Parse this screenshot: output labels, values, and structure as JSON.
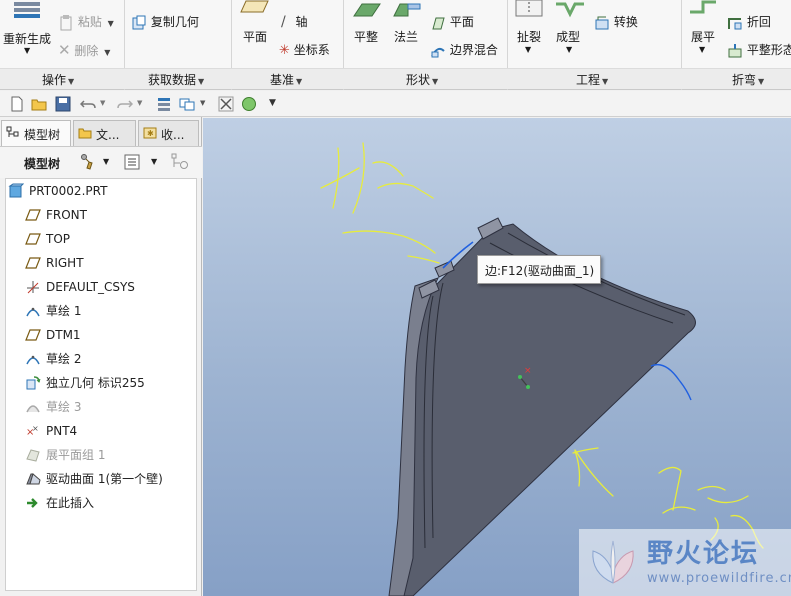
{
  "ribbon": {
    "regenerate_label": "重新生成",
    "paste_label": "粘贴",
    "delete_label": "删除",
    "copy_geometry_label": "复制几何",
    "plane_label": "平面",
    "axis_label": "轴",
    "csys_label": "坐标系",
    "flatten_label": "平整",
    "flange_label": "法兰",
    "surf_plane_label": "平面",
    "boundary_blend_label": "边界混合",
    "rip_label": "扯裂",
    "form_label": "成型",
    "convert_label": "转换",
    "unbend_label": "展平",
    "bend_back_label": "折回",
    "flat_pattern_label": "平整形态",
    "groups": {
      "operations": "操作",
      "get_data": "获取数据",
      "datum": "基准",
      "shapes": "形状",
      "engineering": "工程",
      "bends": "折弯"
    }
  },
  "left_panel": {
    "tabs": [
      "模型树",
      "文...",
      "收..."
    ],
    "tree_header": "模型树"
  },
  "tree": {
    "items": [
      {
        "label": "PRT0002.PRT",
        "icon": "part-icon",
        "dim": false
      },
      {
        "label": "FRONT",
        "icon": "datum-plane-icon",
        "dim": false
      },
      {
        "label": "TOP",
        "icon": "datum-plane-icon",
        "dim": false
      },
      {
        "label": "RIGHT",
        "icon": "datum-plane-icon",
        "dim": false
      },
      {
        "label": "DEFAULT_CSYS",
        "icon": "csys-icon",
        "dim": false
      },
      {
        "label": "草绘 1",
        "icon": "sketch-icon",
        "dim": false
      },
      {
        "label": "DTM1",
        "icon": "datum-plane-icon",
        "dim": false
      },
      {
        "label": "草绘 2",
        "icon": "sketch-icon",
        "dim": false
      },
      {
        "label": "独立几何 标识255",
        "icon": "independent-geometry-icon",
        "dim": false
      },
      {
        "label": "草绘 3",
        "icon": "sketch-icon",
        "dim": true
      },
      {
        "label": "PNT4",
        "icon": "datum-point-icon",
        "dim": false
      },
      {
        "label": "展平面组 1",
        "icon": "flatten-quilt-icon",
        "dim": true
      },
      {
        "label": "驱动曲面 1(第一个壁)",
        "icon": "driving-surface-icon",
        "dim": false
      },
      {
        "label": "在此插入",
        "icon": "insert-here-arrow-icon",
        "dim": false
      }
    ]
  },
  "viewport": {
    "tooltip": "边:F12(驱动曲面_1)"
  },
  "watermark": {
    "title": "野火论坛",
    "url": "www.proewildfire.cn"
  },
  "colors": {
    "accent": "#2e75b6",
    "sketch_yellow": "#e7ec3d",
    "highlight_blue": "#2060e0",
    "model_gray": "#595e6d"
  }
}
